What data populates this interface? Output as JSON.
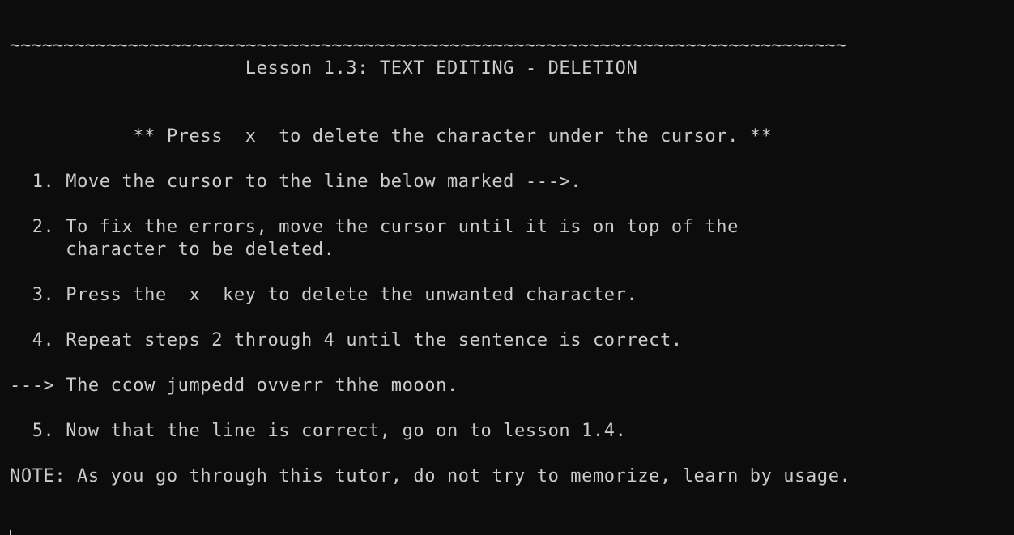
{
  "lines": [
    "~~~~~~~~~~~~~~~~~~~~~~~~~~~~~~~~~~~~~~~~~~~~~~~~~~~~~~~~~~~~~~~~~~~~~~~~~~~~~~",
    "                     Lesson 1.3: TEXT EDITING - DELETION",
    "",
    "",
    "           ** Press  x  to delete the character under the cursor. **",
    "",
    "  1. Move the cursor to the line below marked --->.",
    "",
    "  2. To fix the errors, move the cursor until it is on top of the",
    "     character to be deleted.",
    "",
    "  3. Press the  x  key to delete the unwanted character.",
    "",
    "  4. Repeat steps 2 through 4 until the sentence is correct.",
    "",
    "---> The ccow jumpedd ovverr thhe mooon.",
    "",
    "  5. Now that the line is correct, go on to lesson 1.4.",
    "",
    "NOTE: As you go through this tutor, do not try to memorize, learn by usage."
  ],
  "colors": {
    "background": "#0c0c0c",
    "foreground": "#cccccc"
  }
}
